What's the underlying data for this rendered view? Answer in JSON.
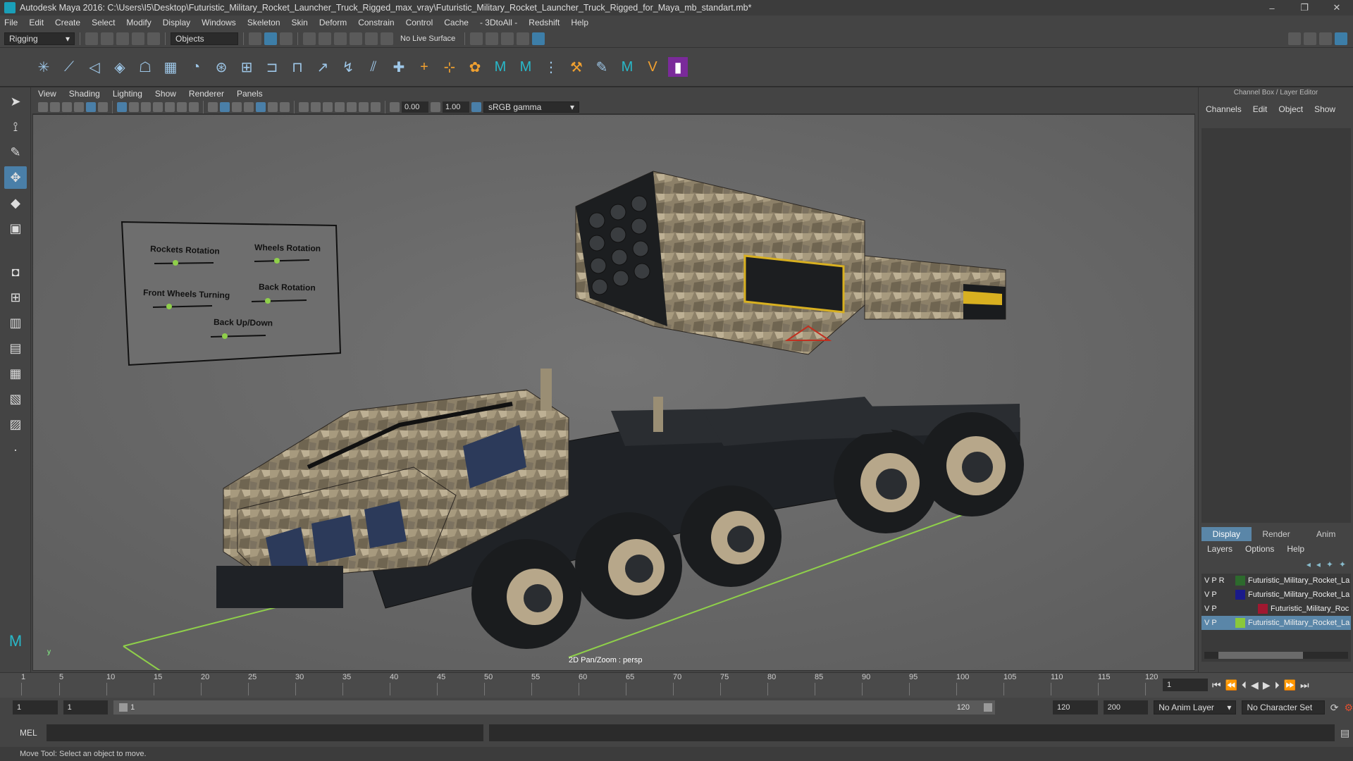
{
  "window": {
    "title": "Autodesk Maya 2016: C:\\Users\\I5\\Desktop\\Futuristic_Military_Rocket_Launcher_Truck_Rigged_max_vray\\Futuristic_Military_Rocket_Launcher_Truck_Rigged_for_Maya_mb_standart.mb*",
    "minimize": "–",
    "restore": "❐",
    "close": "✕"
  },
  "menubar": [
    "File",
    "Edit",
    "Create",
    "Select",
    "Modify",
    "Display",
    "Windows",
    "Skeleton",
    "Skin",
    "Deform",
    "Constrain",
    "Control",
    "Cache",
    "- 3DtoAll -",
    "Redshift",
    "Help"
  ],
  "statusline": {
    "mode": "Rigging",
    "select_mode": "Objects",
    "live_surface": "No Live Surface"
  },
  "panel": {
    "menu": [
      "View",
      "Shading",
      "Lighting",
      "Show",
      "Renderer",
      "Panels"
    ],
    "exposure": "0.00",
    "gamma": "1.00",
    "colorspace": "sRGB gamma"
  },
  "viewport": {
    "label": "2D Pan/Zoom : persp",
    "axis": "y",
    "control_board": {
      "rockets_rotation": "Rockets Rotation",
      "wheels_rotation": "Wheels Rotation",
      "front_wheels_turning": "Front Wheels Turning",
      "back_rotation": "Back Rotation",
      "back_updown": "Back Up/Down"
    }
  },
  "channel_box": {
    "title": "Channel Box / Layer Editor",
    "tabs": [
      "Channels",
      "Edit",
      "Object",
      "Show"
    ]
  },
  "layer_editor": {
    "tabs": [
      "Display",
      "Render",
      "Anim"
    ],
    "menu": [
      "Layers",
      "Options",
      "Help"
    ],
    "layers": [
      {
        "flags": "V  P  R",
        "name": "Futuristic_Military_Rocket_La",
        "color": "#2d6a2d"
      },
      {
        "flags": "V  P",
        "name": "Futuristic_Military_Rocket_La",
        "color": "#1a1a8a"
      },
      {
        "flags": "V     P",
        "name": "Futuristic_Military_Roc",
        "color": "#a01830"
      },
      {
        "flags": "V  P",
        "name": "Futuristic_Military_Rocket_La",
        "color": "#8ac83a"
      }
    ]
  },
  "timeline": {
    "ticks": [
      "1",
      "5",
      "10",
      "15",
      "20",
      "25",
      "30",
      "35",
      "40",
      "45",
      "50",
      "55",
      "60",
      "65",
      "70",
      "75",
      "80",
      "85",
      "90",
      "95",
      "100",
      "105",
      "110",
      "115",
      "120"
    ],
    "current_frame": "1"
  },
  "range": {
    "start": "1",
    "playback_start": "1",
    "slider_start": "1",
    "slider_end": "120",
    "playback_end": "120",
    "end": "200",
    "anim_layer": "No Anim Layer",
    "character_set": "No Character Set"
  },
  "cmdline": {
    "label": "MEL"
  },
  "helpline": {
    "text": "Move Tool: Select an object to move."
  }
}
